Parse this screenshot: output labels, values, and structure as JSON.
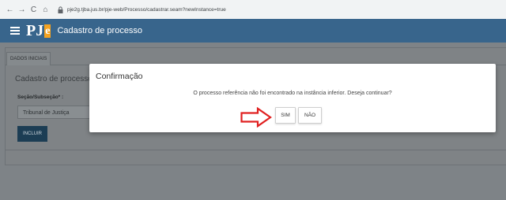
{
  "browser": {
    "url": "pje2g.tjba.jus.br/pje-web/Processo/cadastrar.seam?newInstance=true",
    "back_icon": "←",
    "forward_icon": "→",
    "reload_icon": "C",
    "home_icon": "⌂"
  },
  "header": {
    "logo_main": "PJ",
    "logo_accent": "e",
    "title": "Cadastro de processo"
  },
  "background_form": {
    "tab_label": "DADOS INICIAIS",
    "heading": "Cadastro de processo",
    "section_label": "Seção/Subseção* :",
    "select_value": "Tribunal de Justiça",
    "submit_label": "INCLUIR"
  },
  "dialog": {
    "title": "Confirmação",
    "message": "O processo referência não foi encontrado na instância inferior. Deseja continuar?",
    "confirm_label": "SIM",
    "cancel_label": "NÃO"
  },
  "colors": {
    "header_bg": "#38658c",
    "logo_accent": "#f4a322",
    "arrow": "#e02020",
    "overlay": "#7e8387"
  }
}
